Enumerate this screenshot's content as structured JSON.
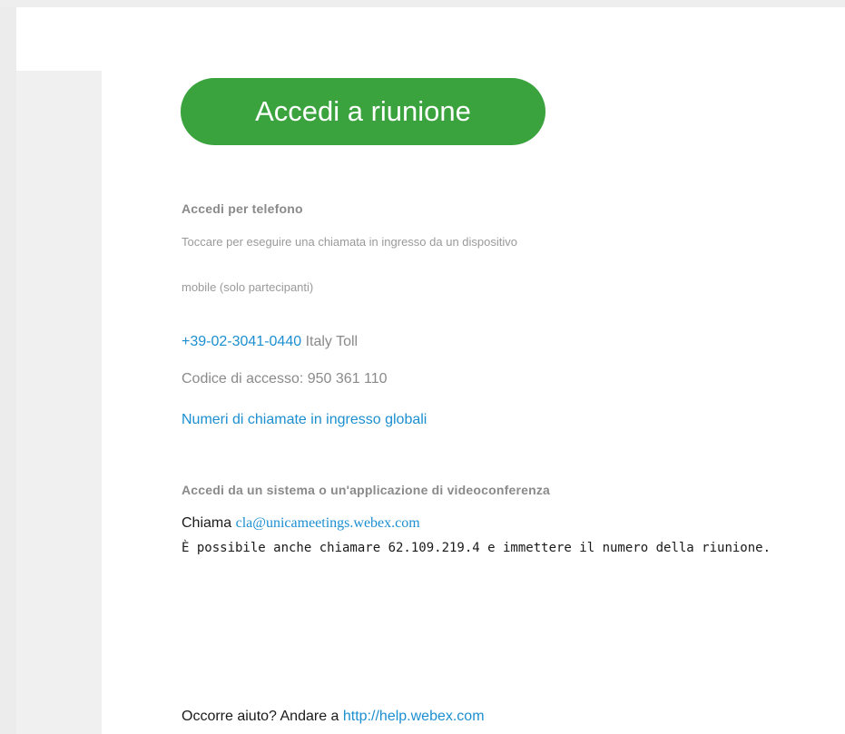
{
  "button": {
    "join_label": "Accedi a riunione"
  },
  "phone": {
    "heading": "Accedi per telefono",
    "desc_line1": "Toccare per eseguire una chiamata in ingresso da un dispositivo",
    "desc_line2": "mobile (solo partecipanti)",
    "number": "+39-02-3041-0440",
    "number_suffix": "Italy Toll",
    "access_code_label": "Codice di accesso:",
    "access_code": "950 361 110",
    "global_numbers_link": "Numeri di chiamate in ingresso globali"
  },
  "video": {
    "heading": "Accedi da un sistema o un'applicazione di videoconferenza",
    "call_label": "Chiama",
    "sip_address": "cla@unicameetings.webex.com",
    "ip_text": "È possibile anche chiamare 62.109.219.4 e immettere il numero della riunione."
  },
  "help": {
    "prefix": "Occorre aiuto? Andare a",
    "link": "http://help.webex.com"
  },
  "colors": {
    "button_green": "#3aa33e",
    "link_blue": "#1c8fd0",
    "muted_gray": "#8a8a8a"
  }
}
